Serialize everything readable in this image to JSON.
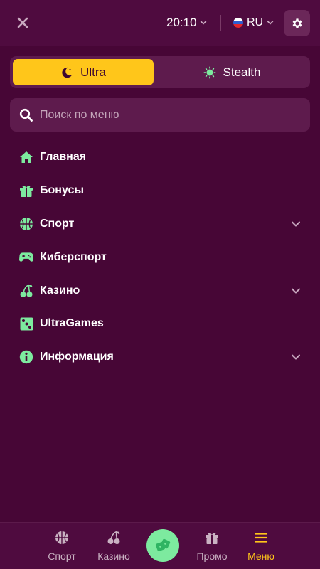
{
  "header": {
    "close_icon": "close-icon",
    "time": "20:10",
    "language": "RU",
    "settings_icon": "gear-icon"
  },
  "mode": {
    "options": [
      {
        "label": "Ultra",
        "icon": "moon-icon",
        "selected": true
      },
      {
        "label": "Stealth",
        "icon": "sun-icon",
        "selected": false
      }
    ]
  },
  "search": {
    "placeholder": "Поиск по меню"
  },
  "menu": {
    "items": [
      {
        "label": "Главная",
        "icon": "home-icon",
        "expandable": false
      },
      {
        "label": "Бонусы",
        "icon": "gift-icon",
        "expandable": false
      },
      {
        "label": "Спорт",
        "icon": "basketball-icon",
        "expandable": true
      },
      {
        "label": "Киберспорт",
        "icon": "gamepad-icon",
        "expandable": false
      },
      {
        "label": "Казино",
        "icon": "cherries-icon",
        "expandable": true
      },
      {
        "label": "UltraGames",
        "icon": "dice-icon",
        "expandable": false
      },
      {
        "label": "Информация",
        "icon": "info-icon",
        "expandable": true
      }
    ]
  },
  "bottom_nav": {
    "items": [
      {
        "label": "Спорт",
        "icon": "basketball-icon",
        "active": false
      },
      {
        "label": "Казино",
        "icon": "cherries-icon",
        "active": false
      },
      {
        "label": "Промо",
        "icon": "gift-icon",
        "active": false
      },
      {
        "label": "Меню",
        "icon": "hamburger-icon",
        "active": true
      }
    ],
    "center_icon": "dice-icon"
  },
  "colors": {
    "background": "#470636",
    "accent_yellow": "#ffc61a",
    "accent_green": "#7dea9f",
    "panel": "#5e1b4d"
  }
}
